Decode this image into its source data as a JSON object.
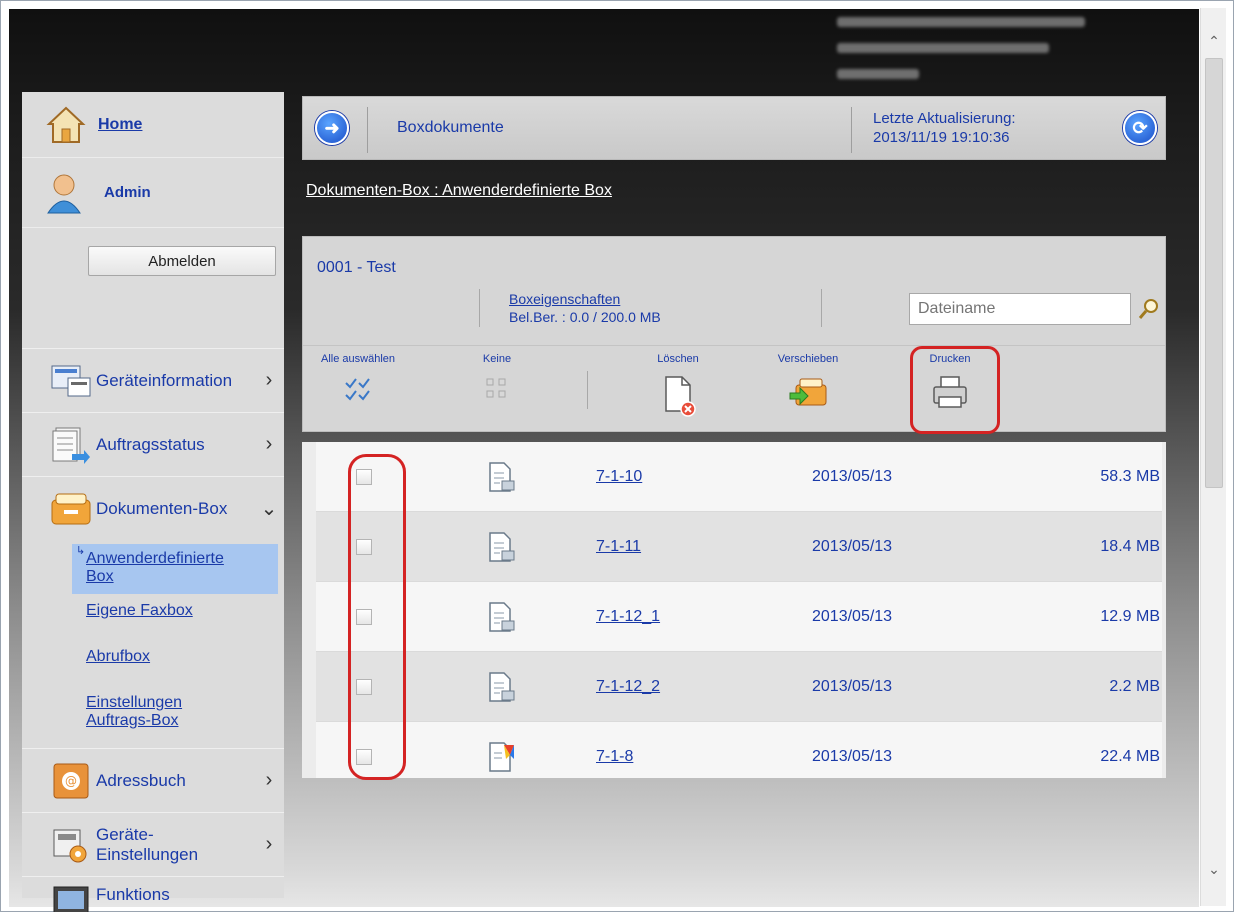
{
  "sidebar": {
    "home": "Home",
    "user": "Admin",
    "logout": "Abmelden",
    "menu": [
      {
        "label": "Geräteinformation",
        "icon": "device-info-icon"
      },
      {
        "label": "Auftragsstatus",
        "icon": "job-status-icon"
      },
      {
        "label": "Dokumenten-Box",
        "icon": "document-box-icon"
      },
      {
        "label": "Adressbuch",
        "icon": "address-book-icon"
      },
      {
        "label": "Geräte-",
        "label2": "Einstellungen",
        "icon": "device-settings-icon"
      },
      {
        "label": "Funktions",
        "icon": "function-settings-icon"
      }
    ],
    "submenu": {
      "custom_box_1": "Anwenderdefinierte",
      "custom_box_2": "Box",
      "fax_box": "Eigene Faxbox",
      "polling_box": "Abrufbox",
      "job_box_settings_1": "Einstellungen",
      "job_box_settings_2": "Auftrags-Box"
    }
  },
  "header": {
    "title": "Boxdokumente",
    "updated_label": "Letzte Aktualisierung:",
    "updated_time": "2013/11/19 19:10:36"
  },
  "breadcrumb": "Dokumenten-Box : Anwenderdefinierte Box",
  "box": {
    "name": "0001 - Test",
    "properties_link": "Boxeigenschaften",
    "usage": "Bel.Ber. : 0.0 / 200.0 MB",
    "search_placeholder": "Dateiname"
  },
  "toolbar": {
    "select_all": "Alle auswählen",
    "none": "Keine",
    "delete": "Löschen",
    "move": "Verschieben",
    "print": "Drucken"
  },
  "files": [
    {
      "name": "7-1-10",
      "date": "2013/05/13",
      "size": "58.3 MB",
      "icon": "scan-document-icon"
    },
    {
      "name": "7-1-11",
      "date": "2013/05/13",
      "size": "18.4 MB",
      "icon": "scan-document-icon"
    },
    {
      "name": "7-1-12_1",
      "date": "2013/05/13",
      "size": "12.9 MB",
      "icon": "scan-document-icon"
    },
    {
      "name": "7-1-12_2",
      "date": "2013/05/13",
      "size": "2.2 MB",
      "icon": "scan-document-icon"
    },
    {
      "name": "7-1-8",
      "date": "2013/05/13",
      "size": "22.4 MB",
      "icon": "color-document-icon"
    }
  ]
}
